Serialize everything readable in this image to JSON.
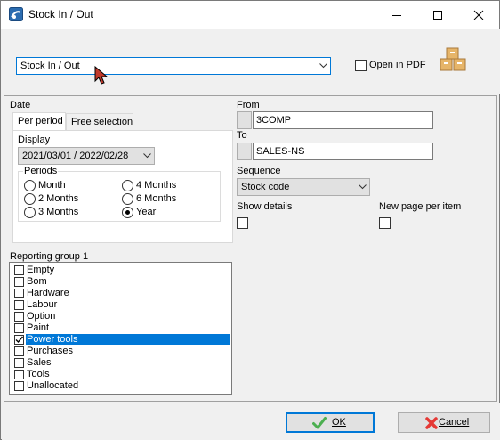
{
  "window": {
    "title": "Stock In / Out"
  },
  "report": {
    "selected": "Stock In / Out",
    "open_in_pdf_label": "Open in PDF",
    "open_in_pdf_checked": false
  },
  "date": {
    "label": "Date",
    "tabs": [
      "Per period",
      "Free selection"
    ],
    "active_tab": "Per period",
    "display_label": "Display",
    "display_value": "2021/03/01 / 2022/02/28",
    "periods_label": "Periods",
    "periods": [
      "Month",
      "4 Months",
      "2 Months",
      "6 Months",
      "3 Months",
      "Year"
    ],
    "selected_period": "Year"
  },
  "from": {
    "label": "From",
    "value": "3COMP"
  },
  "to": {
    "label": "To",
    "value": "SALES-NS"
  },
  "sequence": {
    "label": "Sequence",
    "value": "Stock code"
  },
  "show_details": {
    "label": "Show details",
    "checked": false
  },
  "new_page": {
    "label": "New page per item",
    "checked": false
  },
  "reporting_group": {
    "label": "Reporting group 1",
    "items": [
      "Empty",
      "Bom",
      "Hardware",
      "Labour",
      "Option",
      "Paint",
      "Power tools",
      "Purchases",
      "Sales",
      "Tools",
      "Unallocated"
    ],
    "checked": [
      "Power tools"
    ],
    "selected": "Power tools"
  },
  "buttons": {
    "ok": "OK",
    "cancel": "Cancel"
  },
  "colors": {
    "accent": "#0078d7",
    "ok_icon": "#4caf50",
    "cancel_icon": "#e53935"
  }
}
